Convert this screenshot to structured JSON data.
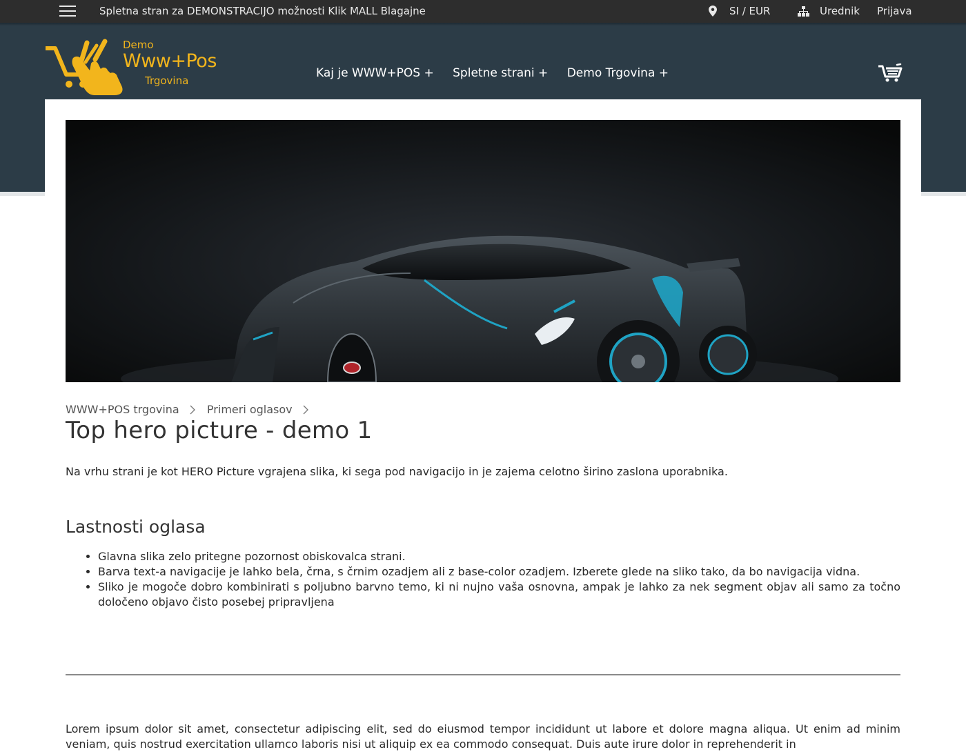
{
  "topbar": {
    "tagline": "Spletna stran za DEMONSTRACIJO možnosti Klik MALL Blagajne",
    "locale": "SI / EUR",
    "editor": "Urednik",
    "login": "Prijava",
    "icons": {
      "menu": "hamburger-menu-icon",
      "locale": "map-pin-icon",
      "editor": "sitemap-icon"
    }
  },
  "logo": {
    "demo": "Demo",
    "main": "Www+Pos",
    "sub": "Trgovina"
  },
  "nav": {
    "items": [
      {
        "label": "Kaj je WWW+POS +"
      },
      {
        "label": "Spletne strani +"
      },
      {
        "label": "Demo Trgovina +"
      }
    ],
    "cart_icon": "shopping-cart-icon"
  },
  "breadcrumb": {
    "items": [
      "WWW+POS trgovina",
      "Primeri oglasov"
    ]
  },
  "page": {
    "title": "Top hero picture - demo 1",
    "intro": "Na vrhu strani je kot HERO Picture vgrajena slika, ki sega pod navigacijo in je zajema celotno širino zaslona uporabnika.",
    "section_title": "Lastnosti oglasa",
    "features": [
      "Glavna slika zelo pritegne pozornost obiskovalca strani.",
      "Barva text-a navigacije je lahko bela, črna, s črnim ozadjem ali z base-color ozadjem. Izberete glede na sliko tako, da bo navigacija vidna.",
      "Sliko je mogoče dobro kombinirati s poljubno barvno temo, ki ni nujno vaša osnovna, ampak je lahko za nek segment objav ali samo za točno določeno objavo čisto posebej pripravljena"
    ],
    "lorem": "Lorem ipsum dolor sit amet, consectetur adipiscing elit, sed do eiusmod tempor incididunt ut labore et dolore magna aliqua. Ut enim ad minim veniam, quis nostrud exercitation ullamco laboris nisi ut aliquip ex ea commodo consequat. Duis aute irure dolor in reprehenderit in"
  },
  "colors": {
    "topbar": "#2d2d2d",
    "header": "#2c3c47",
    "brand_yellow": "#f2b51c",
    "car_accent": "#1fa3c4"
  }
}
